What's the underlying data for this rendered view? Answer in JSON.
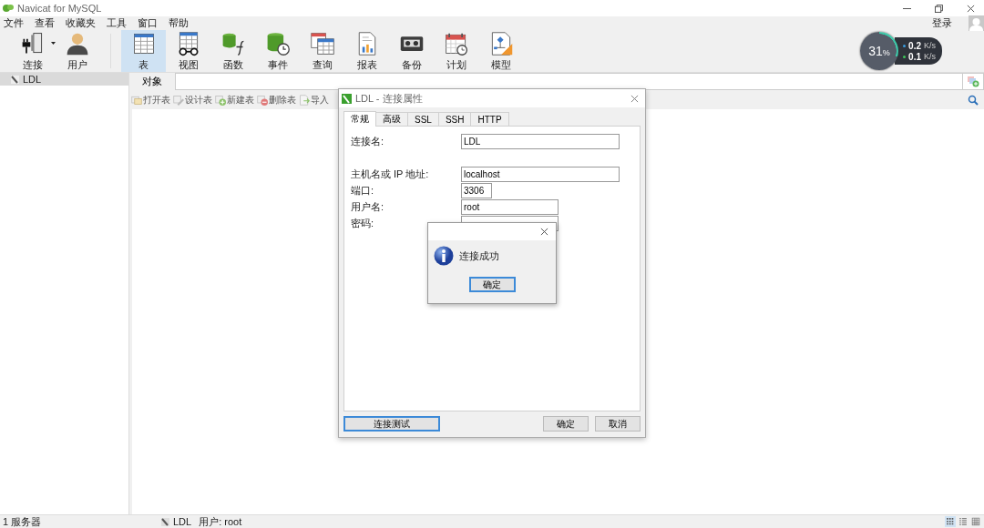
{
  "window": {
    "title": "Navicat for MySQL"
  },
  "menu": [
    "文件",
    "查看",
    "收藏夹",
    "工具",
    "窗口",
    "帮助"
  ],
  "account": {
    "login": "登录"
  },
  "toolbar": [
    {
      "label": "连接",
      "kind": "connection",
      "selected": false
    },
    {
      "label": "用户",
      "kind": "user",
      "selected": false
    },
    {
      "label": "表",
      "kind": "table",
      "selected": true
    },
    {
      "label": "视图",
      "kind": "view",
      "selected": false
    },
    {
      "label": "函数",
      "kind": "function",
      "selected": false
    },
    {
      "label": "事件",
      "kind": "event",
      "selected": false
    },
    {
      "label": "查询",
      "kind": "query",
      "selected": false
    },
    {
      "label": "报表",
      "kind": "report",
      "selected": false
    },
    {
      "label": "备份",
      "kind": "backup",
      "selected": false
    },
    {
      "label": "计划",
      "kind": "schedule",
      "selected": false
    },
    {
      "label": "模型",
      "kind": "model",
      "selected": false
    }
  ],
  "monitor": {
    "percent": "31",
    "percent_unit": "%",
    "upload": "0.2",
    "upload_unit": "K/s",
    "download": "0.1",
    "download_unit": "K/s"
  },
  "sidebar": {
    "items": [
      {
        "label": "LDL",
        "selected": true
      }
    ]
  },
  "object_tabs": [
    {
      "label": "对象",
      "selected": true
    }
  ],
  "object_toolbar": [
    {
      "label": "打开表",
      "kind": "open"
    },
    {
      "label": "设计表",
      "kind": "design"
    },
    {
      "label": "新建表",
      "kind": "new"
    },
    {
      "label": "删除表",
      "kind": "delete"
    },
    {
      "label": "导入",
      "kind": "import"
    }
  ],
  "status_bar": {
    "count": "1 服务器",
    "connection": "LDL",
    "user": "用户: root",
    "views": [
      {
        "kind": "grid",
        "selected": true
      },
      {
        "kind": "list",
        "selected": false
      },
      {
        "kind": "detail",
        "selected": false
      }
    ]
  },
  "dialog": {
    "title": "LDL - 连接属性",
    "tabs": [
      {
        "label": "常规",
        "selected": true
      },
      {
        "label": "高级",
        "selected": false
      },
      {
        "label": "SSL",
        "selected": false
      },
      {
        "label": "SSH",
        "selected": false
      },
      {
        "label": "HTTP",
        "selected": false
      }
    ],
    "fields": [
      {
        "label": "连接名:",
        "value": "LDL"
      },
      {
        "label": "主机名或 IP 地址:",
        "value": "localhost"
      },
      {
        "label": "端口:",
        "value": "3306"
      },
      {
        "label": "用户名:",
        "value": "root"
      },
      {
        "label": "密码:"
      }
    ],
    "buttons": [
      {
        "label": "连接测试",
        "focused": true
      },
      {
        "label": "确定",
        "focused": false
      },
      {
        "label": "取消",
        "focused": false
      }
    ]
  },
  "message": {
    "text": "连接成功",
    "button": {
      "label": "确定",
      "focused": true
    }
  }
}
